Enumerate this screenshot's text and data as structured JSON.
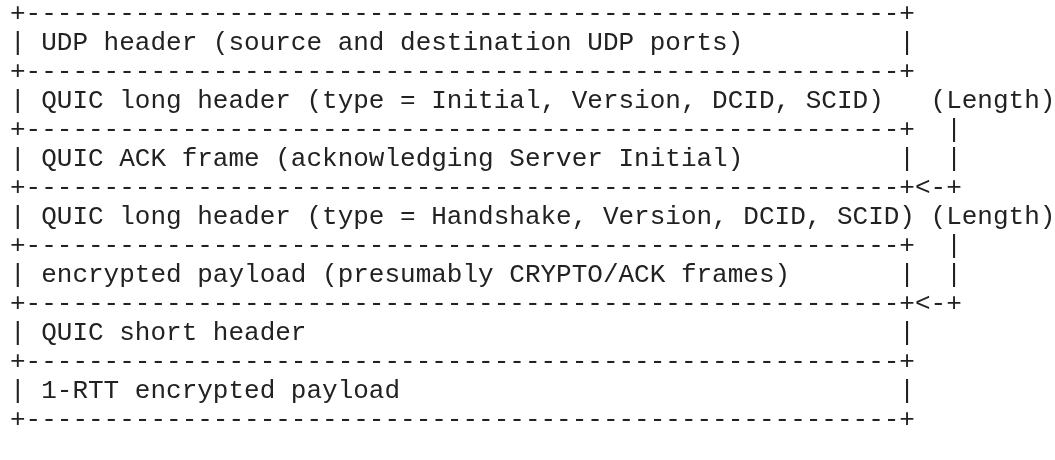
{
  "figure": {
    "lines": [
      "+--------------------------------------------------------+",
      "| UDP header (source and destination UDP ports)          |",
      "+--------------------------------------------------------+",
      "| QUIC long header (type = Initial, Version, DCID, SCID)   (Length)",
      "+--------------------------------------------------------+  |",
      "| QUIC ACK frame (acknowledging Server Initial)          |  |",
      "+--------------------------------------------------------+<-+",
      "| QUIC long header (type = Handshake, Version, DCID, SCID) (Length)",
      "+--------------------------------------------------------+  |",
      "| encrypted payload (presumably CRYPTO/ACK frames)       |  |",
      "+--------------------------------------------------------+<-+",
      "| QUIC short header                                      |",
      "+--------------------------------------------------------+",
      "| 1-RTT encrypted payload                                |",
      "+--------------------------------------------------------+"
    ]
  }
}
